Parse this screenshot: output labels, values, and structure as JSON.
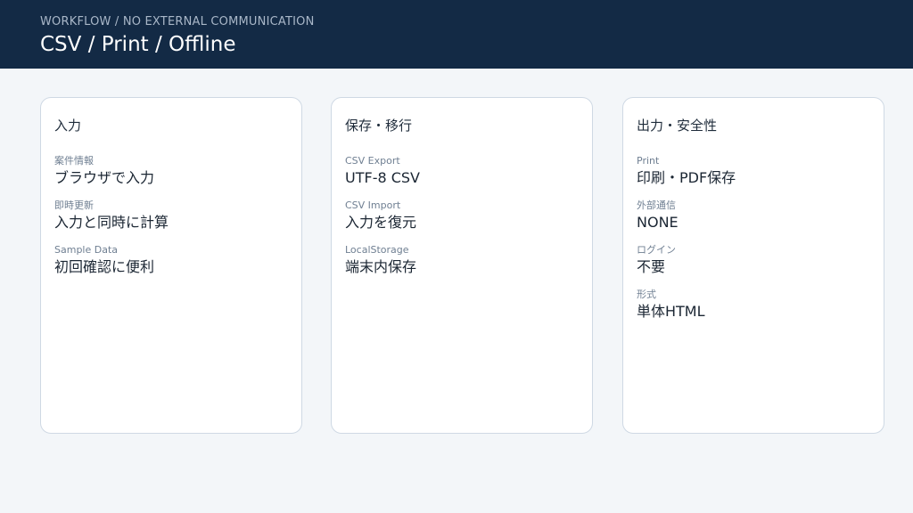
{
  "header": {
    "eyebrow": "WORKFLOW / NO EXTERNAL COMMUNICATION",
    "title": "CSV / Print / Offline"
  },
  "colors": {
    "header_bg": "#132a45",
    "page_bg": "#f3f6f9",
    "card_border": "#cfd9e4"
  },
  "cards": [
    {
      "title": "入力",
      "fields": [
        {
          "label": "案件情報",
          "value": "ブラウザで入力"
        },
        {
          "label": "即時更新",
          "value": "入力と同時に計算"
        },
        {
          "label": "Sample Data",
          "value": "初回確認に便利"
        }
      ]
    },
    {
      "title": "保存・移行",
      "fields": [
        {
          "label": "CSV Export",
          "value": "UTF-8 CSV"
        },
        {
          "label": "CSV Import",
          "value": "入力を復元"
        },
        {
          "label": "LocalStorage",
          "value": "端末内保存"
        }
      ]
    },
    {
      "title": "出力・安全性",
      "fields": [
        {
          "label": "Print",
          "value": "印刷・PDF保存"
        },
        {
          "label": "外部通信",
          "value": "NONE"
        },
        {
          "label": "ログイン",
          "value": "不要"
        },
        {
          "label": "形式",
          "value": "単体HTML"
        }
      ]
    }
  ]
}
